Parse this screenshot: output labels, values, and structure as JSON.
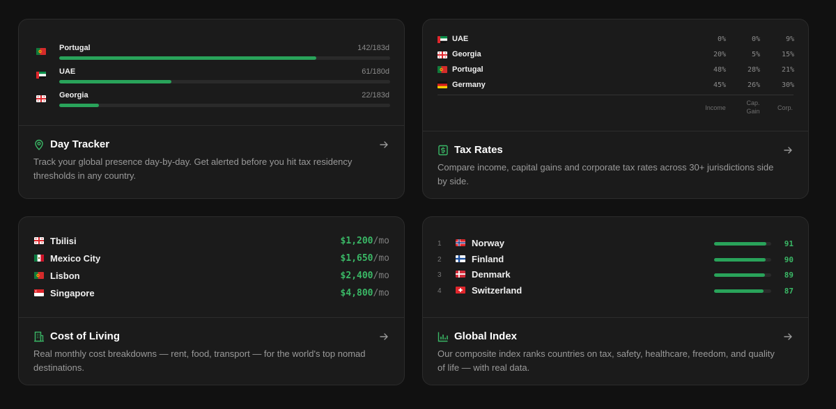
{
  "day_tracker": {
    "rows": [
      {
        "country": "Portugal",
        "count": "142/183d",
        "progress": 0.776
      },
      {
        "country": "UAE",
        "count": "61/180d",
        "progress": 0.339
      },
      {
        "country": "Georgia",
        "count": "22/183d",
        "progress": 0.12
      }
    ],
    "title": "Day Tracker",
    "description": "Track your global presence day-by-day. Get alerted before you hit tax residency thresholds in any country.",
    "icon": "location-pin-icon"
  },
  "tax_rates": {
    "rows": [
      {
        "country": "UAE",
        "income": "0%",
        "cap_gain": "0%",
        "corp": "9%"
      },
      {
        "country": "Georgia",
        "income": "20%",
        "cap_gain": "5%",
        "corp": "15%"
      },
      {
        "country": "Portugal",
        "income": "48%",
        "cap_gain": "28%",
        "corp": "21%"
      },
      {
        "country": "Germany",
        "income": "45%",
        "cap_gain": "26%",
        "corp": "30%"
      }
    ],
    "headers": {
      "income": "Income",
      "cap_gain_line1": "Cap.",
      "cap_gain_line2": "Gain",
      "corp": "Corp."
    },
    "title": "Tax Rates",
    "description": "Compare income, capital gains and corporate tax rates across 30+ jurisdictions side by side.",
    "icon": "dollar-document-icon"
  },
  "cost_of_living": {
    "rows": [
      {
        "city": "Tbilisi",
        "amount": "$1,200",
        "unit": "/mo"
      },
      {
        "city": "Mexico City",
        "amount": "$1,650",
        "unit": "/mo"
      },
      {
        "city": "Lisbon",
        "amount": "$2,400",
        "unit": "/mo"
      },
      {
        "city": "Singapore",
        "amount": "$4,800",
        "unit": "/mo"
      }
    ],
    "title": "Cost of Living",
    "description": "Real monthly cost breakdowns — rent, food, transport — for the world's top nomad destinations.",
    "icon": "building-icon"
  },
  "global_index": {
    "rows": [
      {
        "rank": "1",
        "country": "Norway",
        "score": "91",
        "progress": 0.91
      },
      {
        "rank": "2",
        "country": "Finland",
        "score": "90",
        "progress": 0.9
      },
      {
        "rank": "3",
        "country": "Denmark",
        "score": "89",
        "progress": 0.89
      },
      {
        "rank": "4",
        "country": "Switzerland",
        "score": "87",
        "progress": 0.87
      }
    ],
    "title": "Global Index",
    "description": "Our composite index ranks countries on tax, safety, healthcare, freedom, and quality of life — with real data.",
    "icon": "bar-chart-icon"
  },
  "colors": {
    "accent": "#29a35a",
    "accent_text": "#3ab866",
    "card_bg": "#1b1b1b",
    "page_bg": "#111111"
  }
}
